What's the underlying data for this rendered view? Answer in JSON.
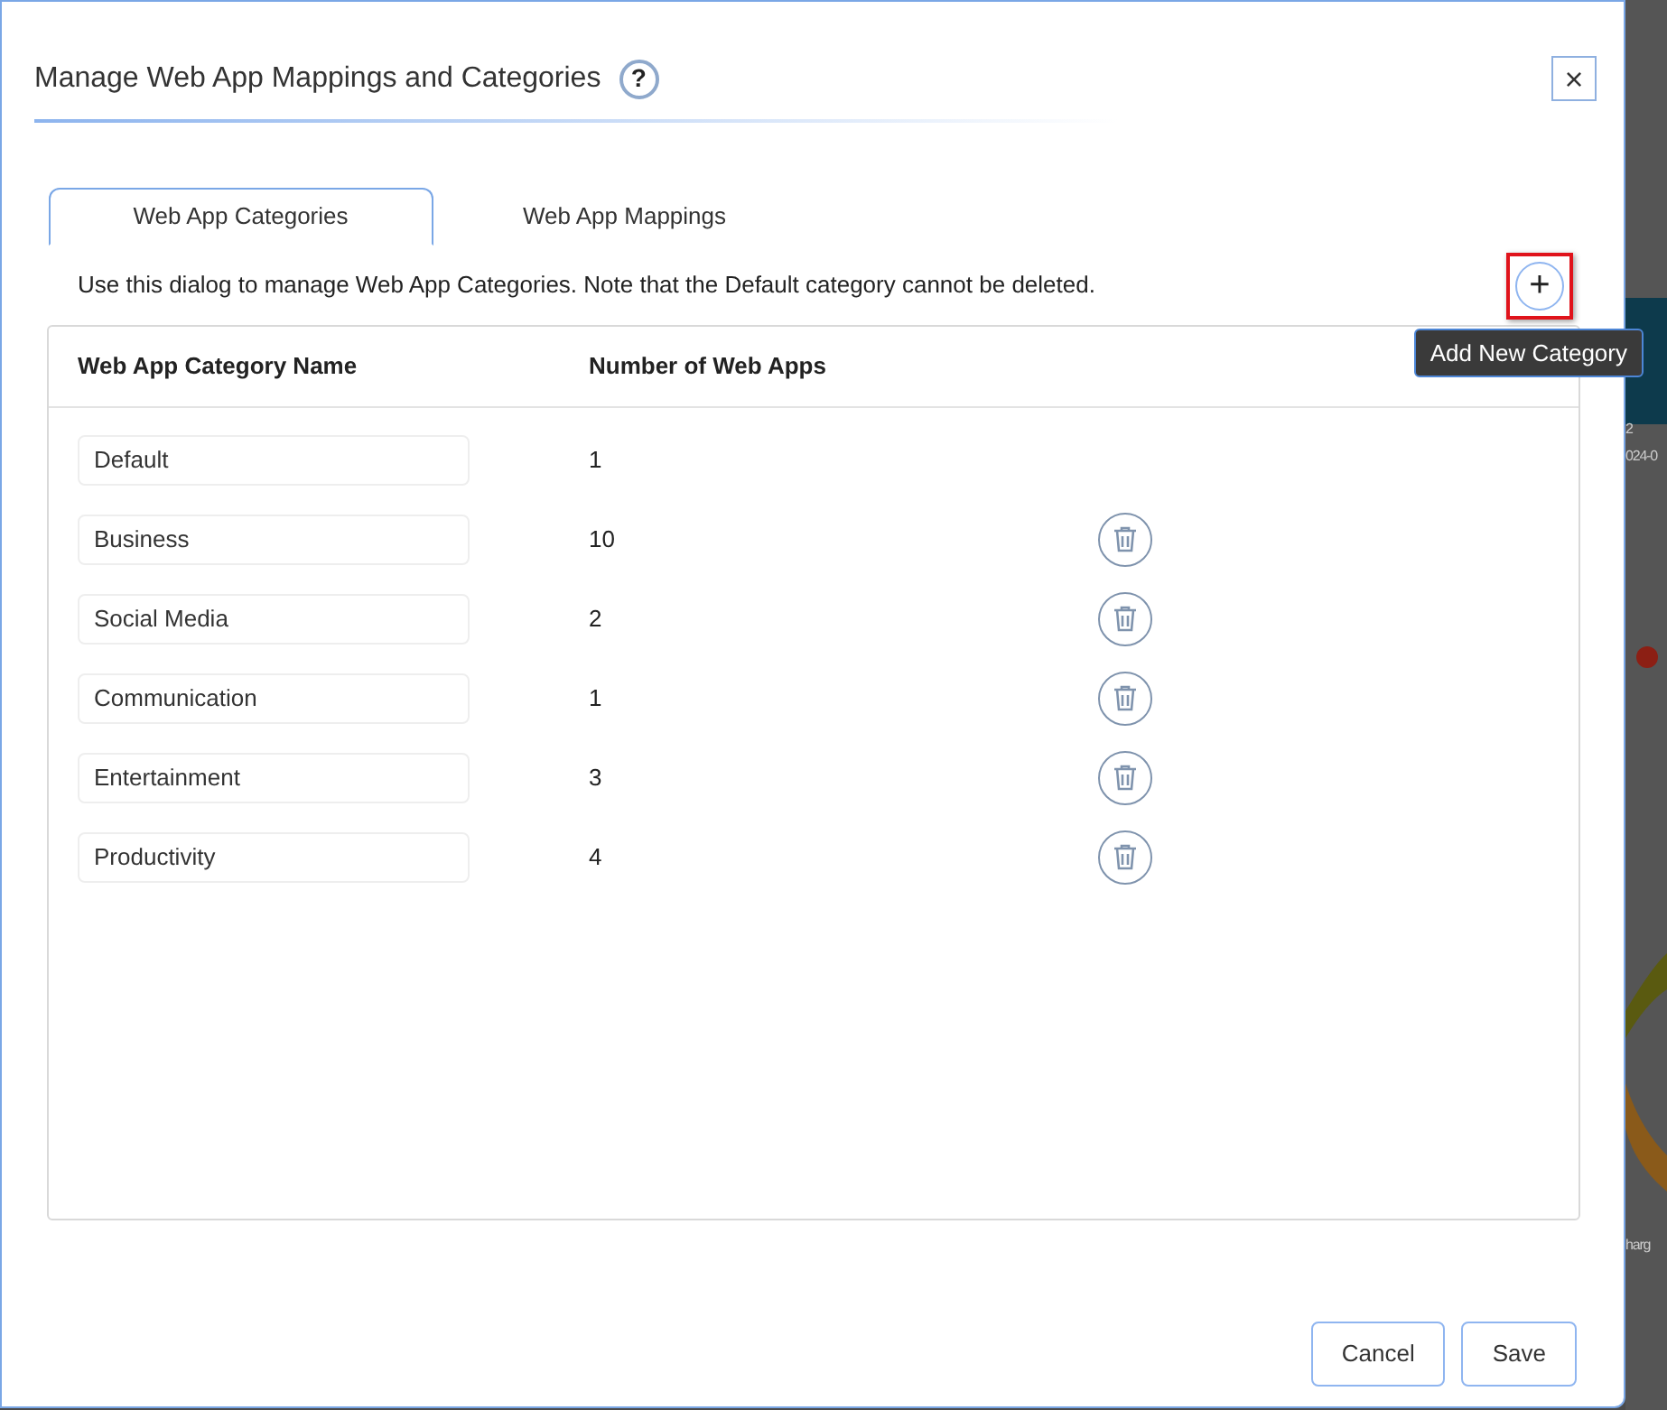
{
  "dialog": {
    "title": "Manage Web App Mappings and Categories",
    "help_icon": "?",
    "close_icon": "×"
  },
  "tabs": [
    {
      "label": "Web App Categories",
      "selected": true
    },
    {
      "label": "Web App Mappings",
      "selected": false
    }
  ],
  "description": "Use this dialog to manage Web App Categories. Note that the Default category cannot be deleted.",
  "add_button": {
    "icon": "+",
    "highlighted": true,
    "tooltip": "Add New Category"
  },
  "table": {
    "columns": [
      "Web App Category Name",
      "Number of Web Apps"
    ],
    "rows": [
      {
        "name": "Default",
        "count": "1",
        "deletable": false
      },
      {
        "name": "Business",
        "count": "10",
        "deletable": true
      },
      {
        "name": "Social Media",
        "count": "2",
        "deletable": true
      },
      {
        "name": "Communication",
        "count": "1",
        "deletable": true
      },
      {
        "name": "Entertainment",
        "count": "3",
        "deletable": true
      },
      {
        "name": "Productivity",
        "count": "4",
        "deletable": true
      }
    ]
  },
  "buttons": [
    "Cancel",
    "Save"
  ],
  "background_texts": [
    "2",
    "024-0",
    "harg"
  ]
}
